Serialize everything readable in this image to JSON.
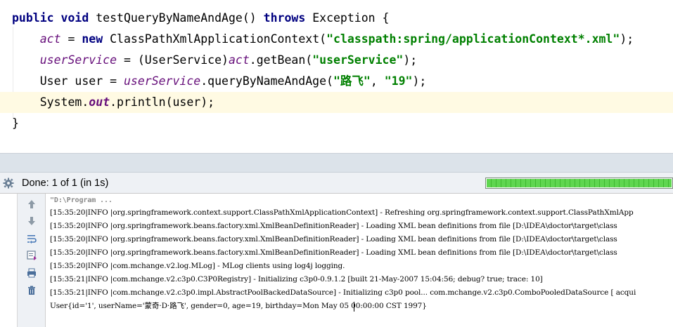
{
  "editor": {
    "lines": [
      {
        "tokens": [
          {
            "t": "kw",
            "v": "public"
          },
          {
            "t": "pln",
            "v": " "
          },
          {
            "t": "kw",
            "v": "void"
          },
          {
            "t": "pln",
            "v": " testQueryByNameAndAge() "
          },
          {
            "t": "kw",
            "v": "throws"
          },
          {
            "t": "pln",
            "v": " Exception {"
          }
        ]
      },
      {
        "tokens": [
          {
            "t": "pln",
            "v": "    "
          },
          {
            "t": "fld",
            "v": "act"
          },
          {
            "t": "pln",
            "v": " = "
          },
          {
            "t": "kw",
            "v": "new"
          },
          {
            "t": "pln",
            "v": " ClassPathXmlApplicationContext("
          },
          {
            "t": "str",
            "v": "\"classpath:spring/applicationContext*.xml\""
          },
          {
            "t": "pln",
            "v": ");"
          }
        ]
      },
      {
        "tokens": [
          {
            "t": "pln",
            "v": "    "
          },
          {
            "t": "fld",
            "v": "userService"
          },
          {
            "t": "pln",
            "v": " = (UserService)"
          },
          {
            "t": "fld",
            "v": "act"
          },
          {
            "t": "pln",
            "v": ".getBean("
          },
          {
            "t": "str",
            "v": "\"userService\""
          },
          {
            "t": "pln",
            "v": ");"
          }
        ]
      },
      {
        "tokens": [
          {
            "t": "pln",
            "v": "    User user = "
          },
          {
            "t": "fld",
            "v": "userService"
          },
          {
            "t": "pln",
            "v": ".queryByNameAndAge("
          },
          {
            "t": "str",
            "v": "\"路飞\""
          },
          {
            "t": "pln",
            "v": ", "
          },
          {
            "t": "str",
            "v": "\"19\""
          },
          {
            "t": "pln",
            "v": ");"
          }
        ]
      },
      {
        "tokens": [
          {
            "t": "pln",
            "v": "    System."
          },
          {
            "t": "fldb",
            "v": "out"
          },
          {
            "t": "pln",
            "v": ".println(user);"
          }
        ]
      },
      {
        "tokens": [
          {
            "t": "pln",
            "v": "}"
          }
        ]
      }
    ]
  },
  "run_panel": {
    "status": "Done: 1 of 1 (in 1s)",
    "progress_percent": 100
  },
  "toolbar_icons": [
    "up-arrow-icon",
    "down-arrow-icon",
    "soft-wrap-icon",
    "scroll-to-end-icon",
    "print-icon",
    "trash-icon"
  ],
  "console": {
    "lines": [
      "\"D:\\Program ...",
      "[15:35:20|INFO |org.springframework.context.support.ClassPathXmlApplicationContext] - Refreshing org.springframework.context.support.ClassPathXmlApp",
      "[15:35:20|INFO |org.springframework.beans.factory.xml.XmlBeanDefinitionReader] - Loading XML bean definitions from file [D:\\IDEA\\doctor\\target\\class",
      "[15:35:20|INFO |org.springframework.beans.factory.xml.XmlBeanDefinitionReader] - Loading XML bean definitions from file [D:\\IDEA\\doctor\\target\\class",
      "[15:35:20|INFO |org.springframework.beans.factory.xml.XmlBeanDefinitionReader] - Loading XML bean definitions from file [D:\\IDEA\\doctor\\target\\class",
      "[15:35:20|INFO |com.mchange.v2.log.MLog] - MLog clients using log4j logging.",
      "[15:35:21|INFO |com.mchange.v2.c3p0.C3P0Registry] - Initializing c3p0-0.9.1.2 [built 21-May-2007 15:04:56; debug? true; trace: 10]",
      "[15:35:21|INFO |com.mchange.v2.c3p0.impl.AbstractPoolBackedDataSource] - Initializing c3p0 pool... com.mchange.v2.c3p0.ComboPooledDataSource [ acqui",
      "User{id='1', userName='蒙奇·D·路飞', gender=0, age=19, birthday=Mon May 05 00:00:00 CST 1997}"
    ]
  }
}
